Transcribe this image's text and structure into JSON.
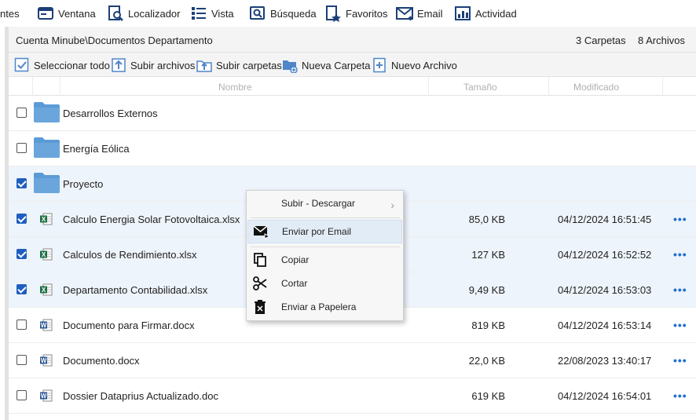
{
  "menubar": {
    "items": [
      {
        "label": "ntes",
        "icon": "clipped-icon"
      },
      {
        "label": "Ventana",
        "icon": "window-icon"
      },
      {
        "label": "Localizador",
        "icon": "locator-icon"
      },
      {
        "label": "Vista",
        "icon": "view-icon"
      },
      {
        "label": "Búsqueda",
        "icon": "search-icon"
      },
      {
        "label": "Favoritos",
        "icon": "favorites-icon"
      },
      {
        "label": "Email",
        "icon": "email-icon"
      },
      {
        "label": "Actividad",
        "icon": "activity-icon"
      }
    ]
  },
  "pathbar": {
    "path": "Cuenta Minube\\Documentos Departamento",
    "folders_count": "3 Carpetas",
    "files_count": "8 Archivos"
  },
  "toolbar": {
    "select_all": "Seleccionar todo",
    "upload_files": "Subir archivos",
    "upload_folders": "Subir carpetas",
    "new_folder": "Nueva Carpeta",
    "new_file": "Nuevo Archivo"
  },
  "columns": {
    "name": "Nombre",
    "size": "Tamaño",
    "modified": "Modificado"
  },
  "rows": [
    {
      "type": "folder",
      "name": "Desarrollos Externos",
      "size": "",
      "modified": "",
      "checked": false
    },
    {
      "type": "folder",
      "name": "Energía Eólica",
      "size": "",
      "modified": "",
      "checked": false
    },
    {
      "type": "folder",
      "name": "Proyecto",
      "size": "",
      "modified": "",
      "checked": true
    },
    {
      "type": "xlsx",
      "name": "Calculo Energia Solar Fotovoltaica.xlsx",
      "size": "85,0 KB",
      "modified": "04/12/2024 16:51:45",
      "checked": true
    },
    {
      "type": "xlsx",
      "name": "Calculos de Rendimiento.xlsx",
      "size": "127 KB",
      "modified": "04/12/2024 16:52:52",
      "checked": true
    },
    {
      "type": "xlsx",
      "name": "Departamento Contabilidad.xlsx",
      "size": "9,49 KB",
      "modified": "04/12/2024 16:53:03",
      "checked": true
    },
    {
      "type": "docx",
      "name": "Documento para Firmar.docx",
      "size": "819 KB",
      "modified": "04/12/2024 16:53:14",
      "checked": false
    },
    {
      "type": "docx",
      "name": "Documento.docx",
      "size": "22,0 KB",
      "modified": "22/08/2023 13:40:17",
      "checked": false
    },
    {
      "type": "docx",
      "name": "Dossier Dataprius Actualizado.doc",
      "size": "619 KB",
      "modified": "04/12/2024 16:54:01",
      "checked": false
    }
  ],
  "more_glyph": "•••",
  "context_menu": {
    "upload_download": "Subir - Descargar",
    "send_email": "Enviar por Email",
    "copy": "Copiar",
    "cut": "Cortar",
    "trash": "Enviar a Papelera"
  },
  "colors": {
    "accent": "#1f5fbf",
    "folder": "#5b9bd5",
    "excel": "#1d7044",
    "word": "#2b5797",
    "selected_row": "#eef4fb"
  }
}
